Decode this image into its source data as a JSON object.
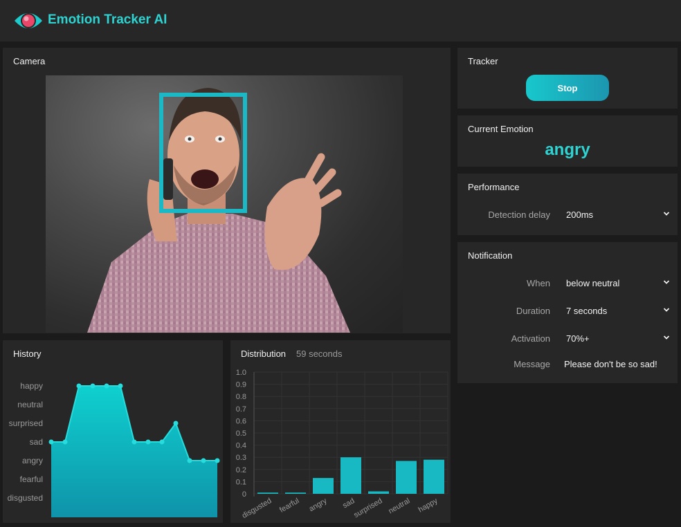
{
  "app": {
    "title": "Emotion Tracker AI",
    "logo_icon": "eye-icon"
  },
  "camera": {
    "title": "Camera"
  },
  "tracker": {
    "title": "Tracker",
    "button_label": "Stop"
  },
  "current_emotion": {
    "title": "Current Emotion",
    "value": "angry"
  },
  "performance": {
    "title": "Performance",
    "delay_label": "Detection delay",
    "delay_value": "200ms"
  },
  "notification": {
    "title": "Notification",
    "when_label": "When",
    "when_value": "below neutral",
    "duration_label": "Duration",
    "duration_value": "7 seconds",
    "activation_label": "Activation",
    "activation_value": "70%+",
    "message_label": "Message",
    "message_value": "Please don't be so sad!"
  },
  "colors": {
    "accent": "#2ed3d2",
    "panel": "#272727",
    "background": "#1b1b1b"
  },
  "history": {
    "title": "History"
  },
  "distribution": {
    "title": "Distribution",
    "subtitle": "59 seconds"
  },
  "chart_data": [
    {
      "type": "area",
      "title": "History",
      "y_categories": [
        "disgusted",
        "fearful",
        "angry",
        "sad",
        "surprised",
        "neutral",
        "happy"
      ],
      "values": [
        "sad",
        "sad",
        "happy",
        "happy",
        "happy",
        "happy",
        "sad",
        "sad",
        "sad",
        "surprised",
        "angry",
        "angry",
        "angry"
      ],
      "color": "#12c2c9"
    },
    {
      "type": "bar",
      "title": "Distribution",
      "categories": [
        "disgusted",
        "fearful",
        "angry",
        "sad",
        "surprised",
        "neutral",
        "happy"
      ],
      "values": [
        0.01,
        0.01,
        0.13,
        0.3,
        0.02,
        0.27,
        0.28
      ],
      "ylim": [
        0,
        1
      ],
      "yticks": [
        "0",
        "0.1",
        "0.2",
        "0.3",
        "0.4",
        "0.5",
        "0.6",
        "0.7",
        "0.8",
        "0.9",
        "1.0"
      ],
      "grid": true,
      "color": "#19b9c3"
    }
  ]
}
